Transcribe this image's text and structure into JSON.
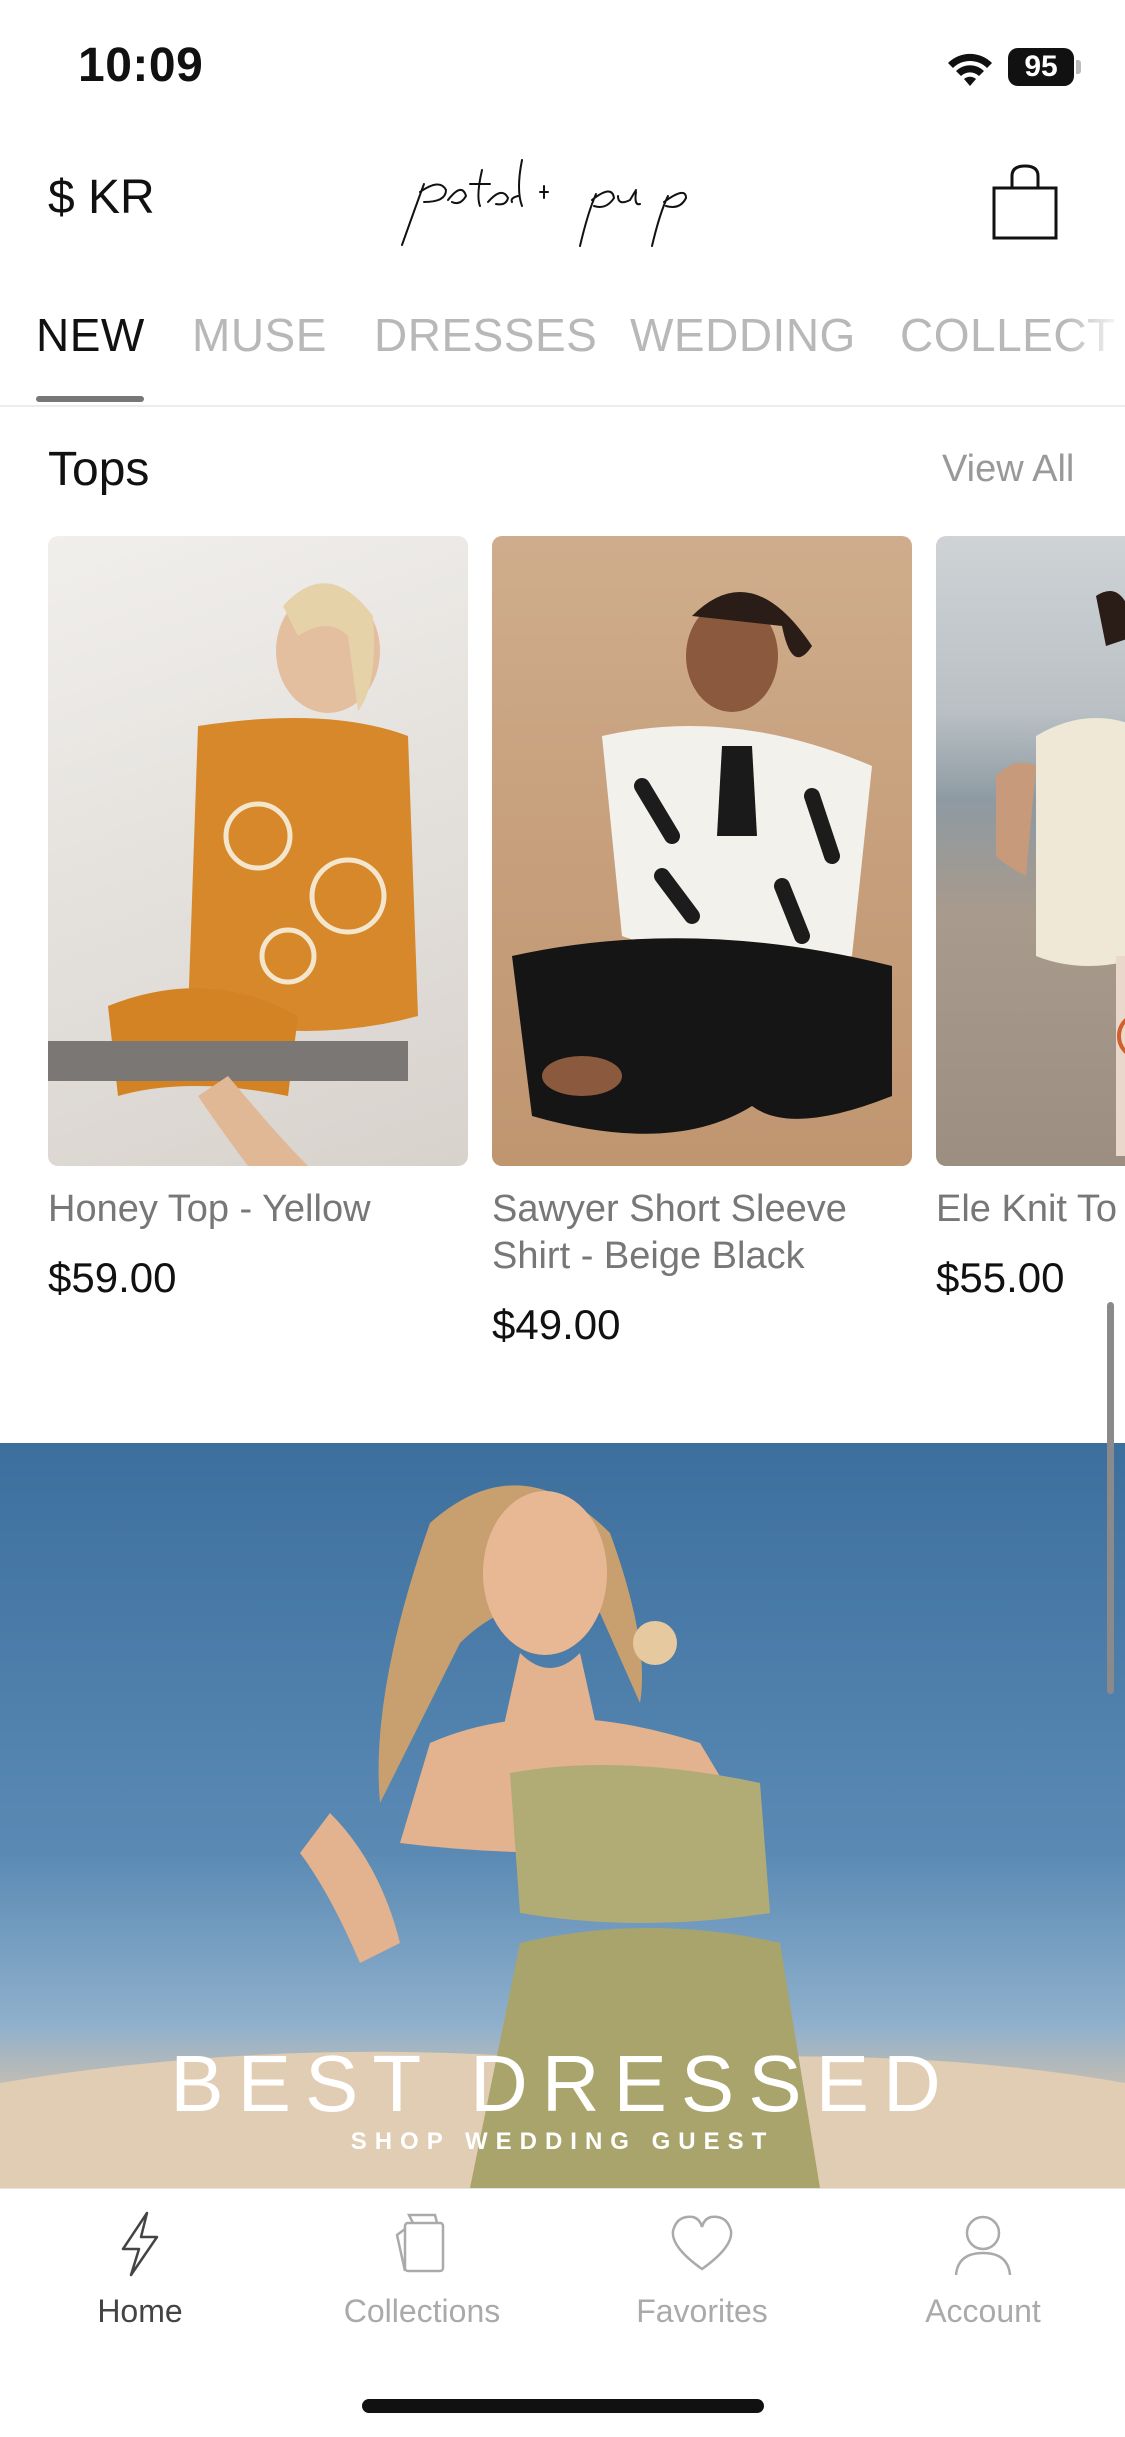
{
  "status_bar": {
    "time": "10:09",
    "battery": "95"
  },
  "header": {
    "currency": "$ KR",
    "logo_text": "petal + pup"
  },
  "tabs": [
    {
      "label": "NEW"
    },
    {
      "label": "MUSE"
    },
    {
      "label": "DRESSES"
    },
    {
      "label": "WEDDING"
    },
    {
      "label": "COLLECT"
    }
  ],
  "section": {
    "title": "Tops",
    "view_all": "View All"
  },
  "products": [
    {
      "name": "Honey Top - Yellow",
      "price": "$59.00"
    },
    {
      "name": "Sawyer Short Sleeve Shirt - Beige Black",
      "price": "$49.00"
    },
    {
      "name": "Ele Knit To",
      "price": "$55.00"
    }
  ],
  "banner": {
    "title": "BEST DRESSED",
    "subtitle": "SHOP WEDDING GUEST"
  },
  "tabbar": [
    {
      "label": "Home",
      "icon": "lightning-icon"
    },
    {
      "label": "Collections",
      "icon": "collections-icon"
    },
    {
      "label": "Favorites",
      "icon": "heart-icon"
    },
    {
      "label": "Account",
      "icon": "person-icon"
    }
  ],
  "colors": {
    "accent": "#111111",
    "muted": "#b8b8b8",
    "banner_sky": "#4a7cab"
  }
}
